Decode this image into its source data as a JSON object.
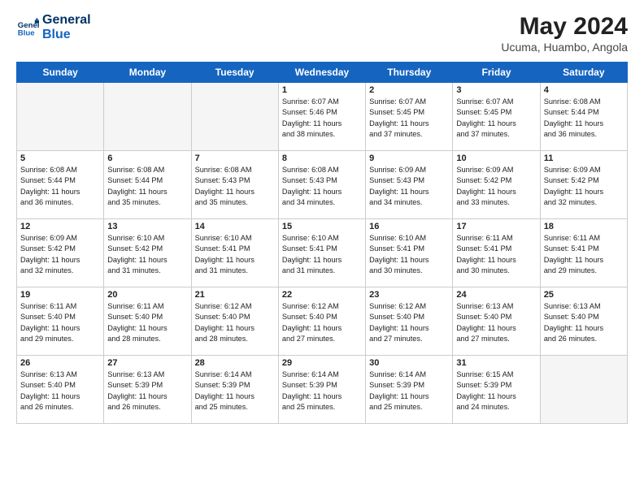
{
  "header": {
    "logo_line1": "General",
    "logo_line2": "Blue",
    "title": "May 2024",
    "subtitle": "Ucuma, Huambo, Angola"
  },
  "weekdays": [
    "Sunday",
    "Monday",
    "Tuesday",
    "Wednesday",
    "Thursday",
    "Friday",
    "Saturday"
  ],
  "weeks": [
    [
      {
        "day": "",
        "info": ""
      },
      {
        "day": "",
        "info": ""
      },
      {
        "day": "",
        "info": ""
      },
      {
        "day": "1",
        "info": "Sunrise: 6:07 AM\nSunset: 5:46 PM\nDaylight: 11 hours\nand 38 minutes."
      },
      {
        "day": "2",
        "info": "Sunrise: 6:07 AM\nSunset: 5:45 PM\nDaylight: 11 hours\nand 37 minutes."
      },
      {
        "day": "3",
        "info": "Sunrise: 6:07 AM\nSunset: 5:45 PM\nDaylight: 11 hours\nand 37 minutes."
      },
      {
        "day": "4",
        "info": "Sunrise: 6:08 AM\nSunset: 5:44 PM\nDaylight: 11 hours\nand 36 minutes."
      }
    ],
    [
      {
        "day": "5",
        "info": "Sunrise: 6:08 AM\nSunset: 5:44 PM\nDaylight: 11 hours\nand 36 minutes."
      },
      {
        "day": "6",
        "info": "Sunrise: 6:08 AM\nSunset: 5:44 PM\nDaylight: 11 hours\nand 35 minutes."
      },
      {
        "day": "7",
        "info": "Sunrise: 6:08 AM\nSunset: 5:43 PM\nDaylight: 11 hours\nand 35 minutes."
      },
      {
        "day": "8",
        "info": "Sunrise: 6:08 AM\nSunset: 5:43 PM\nDaylight: 11 hours\nand 34 minutes."
      },
      {
        "day": "9",
        "info": "Sunrise: 6:09 AM\nSunset: 5:43 PM\nDaylight: 11 hours\nand 34 minutes."
      },
      {
        "day": "10",
        "info": "Sunrise: 6:09 AM\nSunset: 5:42 PM\nDaylight: 11 hours\nand 33 minutes."
      },
      {
        "day": "11",
        "info": "Sunrise: 6:09 AM\nSunset: 5:42 PM\nDaylight: 11 hours\nand 32 minutes."
      }
    ],
    [
      {
        "day": "12",
        "info": "Sunrise: 6:09 AM\nSunset: 5:42 PM\nDaylight: 11 hours\nand 32 minutes."
      },
      {
        "day": "13",
        "info": "Sunrise: 6:10 AM\nSunset: 5:42 PM\nDaylight: 11 hours\nand 31 minutes."
      },
      {
        "day": "14",
        "info": "Sunrise: 6:10 AM\nSunset: 5:41 PM\nDaylight: 11 hours\nand 31 minutes."
      },
      {
        "day": "15",
        "info": "Sunrise: 6:10 AM\nSunset: 5:41 PM\nDaylight: 11 hours\nand 31 minutes."
      },
      {
        "day": "16",
        "info": "Sunrise: 6:10 AM\nSunset: 5:41 PM\nDaylight: 11 hours\nand 30 minutes."
      },
      {
        "day": "17",
        "info": "Sunrise: 6:11 AM\nSunset: 5:41 PM\nDaylight: 11 hours\nand 30 minutes."
      },
      {
        "day": "18",
        "info": "Sunrise: 6:11 AM\nSunset: 5:41 PM\nDaylight: 11 hours\nand 29 minutes."
      }
    ],
    [
      {
        "day": "19",
        "info": "Sunrise: 6:11 AM\nSunset: 5:40 PM\nDaylight: 11 hours\nand 29 minutes."
      },
      {
        "day": "20",
        "info": "Sunrise: 6:11 AM\nSunset: 5:40 PM\nDaylight: 11 hours\nand 28 minutes."
      },
      {
        "day": "21",
        "info": "Sunrise: 6:12 AM\nSunset: 5:40 PM\nDaylight: 11 hours\nand 28 minutes."
      },
      {
        "day": "22",
        "info": "Sunrise: 6:12 AM\nSunset: 5:40 PM\nDaylight: 11 hours\nand 27 minutes."
      },
      {
        "day": "23",
        "info": "Sunrise: 6:12 AM\nSunset: 5:40 PM\nDaylight: 11 hours\nand 27 minutes."
      },
      {
        "day": "24",
        "info": "Sunrise: 6:13 AM\nSunset: 5:40 PM\nDaylight: 11 hours\nand 27 minutes."
      },
      {
        "day": "25",
        "info": "Sunrise: 6:13 AM\nSunset: 5:40 PM\nDaylight: 11 hours\nand 26 minutes."
      }
    ],
    [
      {
        "day": "26",
        "info": "Sunrise: 6:13 AM\nSunset: 5:40 PM\nDaylight: 11 hours\nand 26 minutes."
      },
      {
        "day": "27",
        "info": "Sunrise: 6:13 AM\nSunset: 5:39 PM\nDaylight: 11 hours\nand 26 minutes."
      },
      {
        "day": "28",
        "info": "Sunrise: 6:14 AM\nSunset: 5:39 PM\nDaylight: 11 hours\nand 25 minutes."
      },
      {
        "day": "29",
        "info": "Sunrise: 6:14 AM\nSunset: 5:39 PM\nDaylight: 11 hours\nand 25 minutes."
      },
      {
        "day": "30",
        "info": "Sunrise: 6:14 AM\nSunset: 5:39 PM\nDaylight: 11 hours\nand 25 minutes."
      },
      {
        "day": "31",
        "info": "Sunrise: 6:15 AM\nSunset: 5:39 PM\nDaylight: 11 hours\nand 24 minutes."
      },
      {
        "day": "",
        "info": ""
      }
    ]
  ]
}
